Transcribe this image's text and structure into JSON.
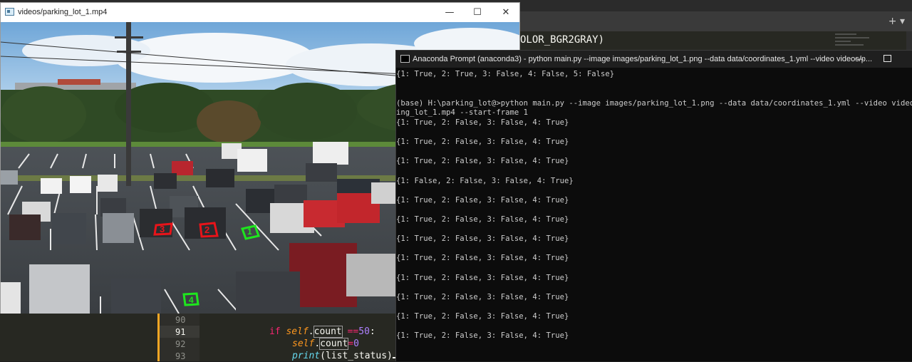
{
  "editor": {
    "code_fragment_top": "OLOR_BGR2GRAY)",
    "tab_controls": "+ ▾",
    "lines": [
      {
        "num": "90"
      },
      {
        "num": "91",
        "kw": "if",
        "self1": "self",
        "dot1": ".",
        "attr1": "count",
        "op1": " ==",
        "n1": "50",
        "colon": ":"
      },
      {
        "num": "92",
        "self2": "self",
        "dot2": ".",
        "attr2": "count",
        "op2": "=",
        "n2": "0"
      },
      {
        "num": "93",
        "fn": "print",
        "args": "(list_status)"
      }
    ]
  },
  "video_window": {
    "title": "videos/parking_lot_1.mp4",
    "minimize": "—",
    "maximize": "☐",
    "close": "✕",
    "spot_labels": [
      "3",
      "2",
      "1",
      "4"
    ],
    "spot_colors": {
      "occupied": "#e8141a",
      "free": "#1ee61e"
    }
  },
  "prompt_window": {
    "title": "Anaconda Prompt (anaconda3) - python  main.py --image images/parking_lot_1.png --data data/coordinates_1.yml --video videos/p...",
    "minimize": "—",
    "output": [
      "{1: True, 2: True, 3: False, 4: False, 5: False}",
      "",
      "",
      "(base) H:\\parking_lot@>python main.py --image images/parking_lot_1.png --data data/coordinates_1.yml --video videos/par",
      "ing_lot_1.mp4 --start-frame 1",
      "{1: True, 2: False, 3: False, 4: True}",
      "",
      "{1: True, 2: False, 3: False, 4: True}",
      "",
      "{1: True, 2: False, 3: False, 4: True}",
      "",
      "{1: False, 2: False, 3: False, 4: True}",
      "",
      "{1: True, 2: False, 3: False, 4: True}",
      "",
      "{1: True, 2: False, 3: False, 4: True}",
      "",
      "{1: True, 2: False, 3: False, 4: True}",
      "",
      "{1: True, 2: False, 3: False, 4: True}",
      "",
      "{1: True, 2: False, 3: False, 4: True}",
      "",
      "{1: True, 2: False, 3: False, 4: True}",
      "",
      "{1: True, 2: False, 3: False, 4: True}",
      "",
      "{1: True, 2: False, 3: False, 4: True}"
    ]
  }
}
